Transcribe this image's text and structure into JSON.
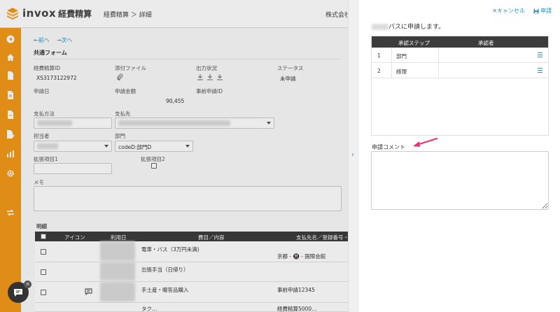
{
  "header": {
    "logo_text": "invox",
    "logo_sub": "経費精算",
    "breadcrumb": "経費精算 ＞ 詳細",
    "company": "株式会社"
  },
  "nav": {
    "prev": "←前へ",
    "next": "→次へ",
    "section_title": "共通フォーム"
  },
  "form": {
    "expense_id_label": "経費精算ID",
    "expense_id": "XS3173122972",
    "attachment_label": "添付ファイル",
    "output_status_label": "出力状況",
    "status_label": "ステータス",
    "status": "未申請",
    "apply_date_label": "申請日",
    "amount_label": "申請金額",
    "amount": "90,455",
    "prior_id_label": "事前申請ID",
    "payment_method_label": "支払方法",
    "payee_label": "支払先",
    "person_label": "担当者",
    "department_label": "部門",
    "department_value": "codeD:部門D",
    "ext1_label": "拡張項目1",
    "ext2_label": "拡張項目2",
    "memo_label": "メモ",
    "detail_title": "明細"
  },
  "details": {
    "columns": [
      "アイコン",
      "利用日",
      "費目／内容",
      "支払先名／登録番号・"
    ],
    "rows": [
      {
        "item": "電車・バス（3万円未満)",
        "payee": "京都 - 🚇 - 国際会館"
      },
      {
        "item": "出張手当（日帰り）",
        "payee": ""
      },
      {
        "item": "手土産・贈答品購入",
        "payee": "事前申請12345"
      },
      {
        "item": "タク…",
        "payee": "経費精算5000…"
      }
    ]
  },
  "panel": {
    "cancel": "✕キャンセル",
    "apply": "申請",
    "message": "パスに申請します。",
    "table_headers": [
      "承認ステップ",
      "承認者"
    ],
    "steps": [
      {
        "no": "1",
        "name": "部門"
      },
      {
        "no": "2",
        "name": "経理"
      }
    ],
    "comment_label": "申請コメント",
    "comment_value": ""
  },
  "colors": {
    "sidebar": "#f29a1a",
    "link": "#2a8fbd",
    "table_header": "#3c3c3c",
    "annotation_arrow": "#e8336d"
  }
}
